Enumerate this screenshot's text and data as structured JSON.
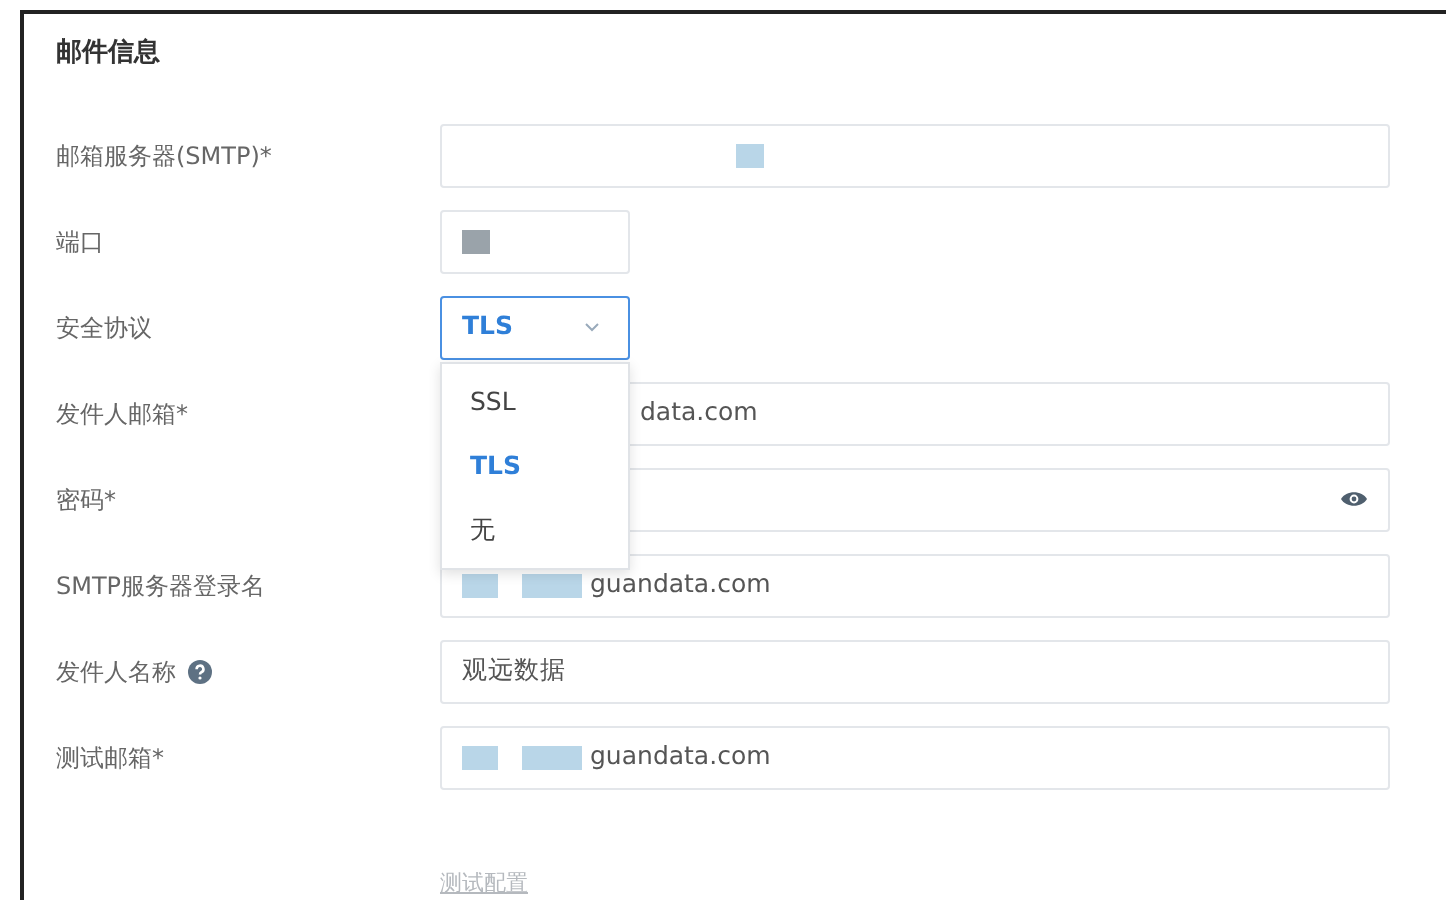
{
  "section_title": "邮件信息",
  "fields": [
    {
      "kind": "text",
      "label": "邮箱服务器(SMTP)*",
      "masked": true
    },
    {
      "kind": "short",
      "label": "端口",
      "masked": true
    },
    {
      "kind": "select",
      "label": "安全协议",
      "value": "TLS",
      "expanded": true,
      "options": [
        {
          "label": "SSL",
          "selected": false
        },
        {
          "label": "TLS",
          "selected": true
        },
        {
          "label": "无",
          "selected": false
        }
      ]
    },
    {
      "kind": "text",
      "label": "发件人邮箱*",
      "value": "data.com",
      "masked": false,
      "covered_by_menu": true
    },
    {
      "kind": "password",
      "label": "密码*",
      "masked": false
    },
    {
      "kind": "text",
      "label": "SMTP服务器登录名",
      "value": "guandata.com",
      "masked": true
    },
    {
      "kind": "text",
      "label": "发件人名称",
      "value": "观远数据",
      "masked": false,
      "help": true
    },
    {
      "kind": "text",
      "label": "测试邮箱*",
      "value": "guandata.com",
      "masked": true
    }
  ],
  "test_link": "测试配置"
}
